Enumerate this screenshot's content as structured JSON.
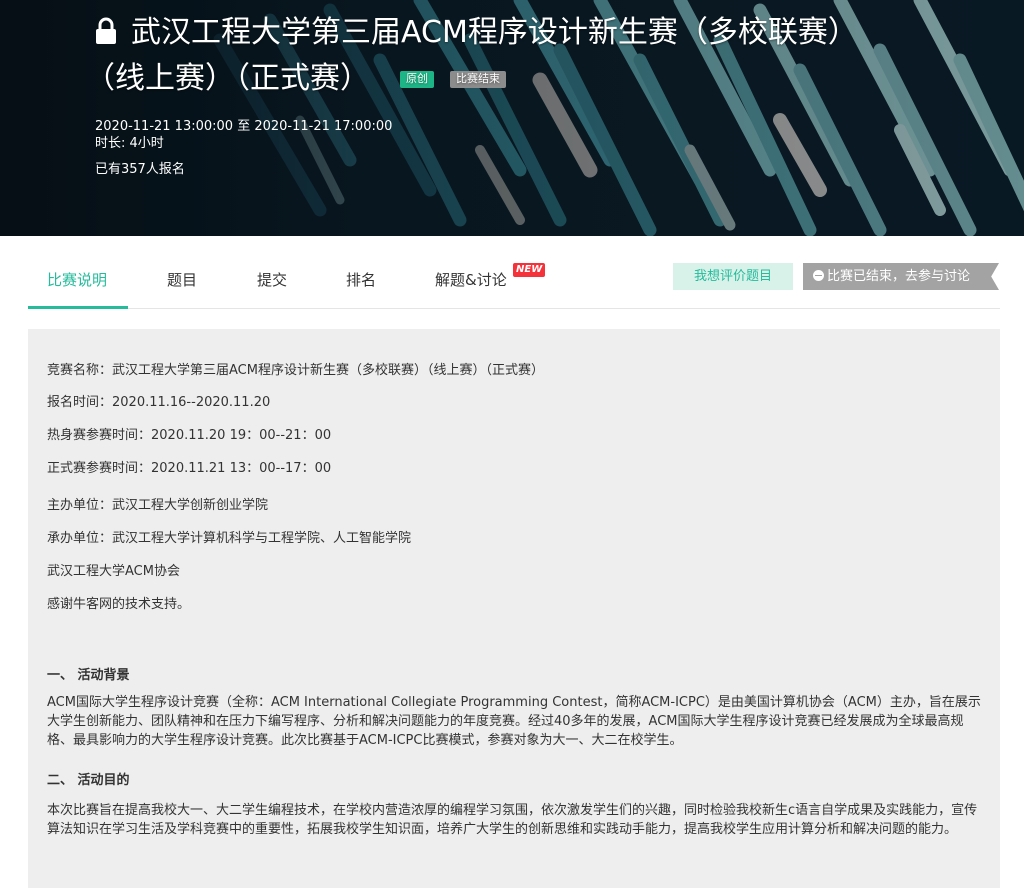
{
  "contest": {
    "title_line1": "武汉工程大学第三届ACM程序设计新生赛（多校联赛）",
    "title_line2": "（线上赛）（正式赛）",
    "badge_original": "原创",
    "badge_status": "比赛结束",
    "time_range": "2020-11-21 13:00:00 至 2020-11-21 17:00:00",
    "duration": "时长: 4小时",
    "signups": "已有357人报名"
  },
  "tabs": [
    {
      "label": "比赛说明"
    },
    {
      "label": "题目"
    },
    {
      "label": "提交"
    },
    {
      "label": "排名"
    },
    {
      "label": "解题&讨论"
    }
  ],
  "new_tag": "NEW",
  "actions": {
    "review_label": "我想评价题目",
    "ended_label": "比赛已结束，去参与讨论"
  },
  "info": {
    "name": "竞赛名称：武汉工程大学第三届ACM程序设计新生赛（多校联赛）（线上赛）（正式赛）",
    "signup_time": "报名时间：2020.11.16--2020.11.20",
    "warmup_time": "热身赛参赛时间：2020.11.20  19：00--21：00",
    "formal_time": "正式赛参赛时间：2020.11.21  13：00--17：00",
    "host": "主办单位：武汉工程大学创新创业学院",
    "organizer": "承办单位：武汉工程大学计算机科学与工程学院、人工智能学院",
    "association": "武汉工程大学ACM协会",
    "thanks": "感谢牛客网的技术支持。"
  },
  "sections": [
    {
      "heading": "一、  活动背景",
      "text": "ACM国际大学生程序设计竞赛（全称：ACM International Collegiate Programming Contest，简称ACM-ICPC）是由美国计算机协会（ACM）主办，旨在展示大学生创新能力、团队精神和在压力下编写程序、分析和解决问题能力的年度竞赛。经过40多年的发展，ACM国际大学生程序设计竞赛已经发展成为全球最高规格、最具影响力的大学生程序设计竞赛。此次比赛基于ACM-ICPC比赛模式，参赛对象为大一、大二在校学生。"
    },
    {
      "heading": "二、 活动目的",
      "text": "本次比赛旨在提高我校大一、大二学生编程技术，在学校内营造浓厚的编程学习氛围，依次激发学生们的兴趣，同时检验我校新生c语言自学成果及实践能力，宣传算法知识在学习生活及学科竞赛中的重要性，拓展我校学生知识面，培养广大学生的创新思维和实践动手能力，提高我校学生应用计算分析和解决问题的能力。"
    }
  ],
  "colors": {
    "accent": "#25bb9b",
    "banner_bg": "#0b1d28",
    "new_tag": "#f5313a",
    "panel_bg": "#eeeeee"
  }
}
